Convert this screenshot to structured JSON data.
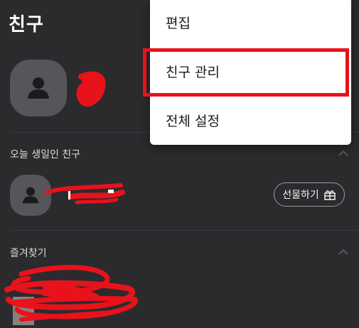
{
  "header": {
    "title": "친구"
  },
  "sections": {
    "birthday": {
      "label": "오늘 생일인 친구",
      "gift_button": "선물하기"
    },
    "favorites": {
      "label": "즐겨찾기"
    }
  },
  "menu": {
    "items": [
      {
        "label": "편집"
      },
      {
        "label": "친구 관리",
        "highlighted": true
      },
      {
        "label": "전체 설정"
      }
    ]
  },
  "colors": {
    "background": "#2b2b2e",
    "avatar": "#55555a",
    "menu_background": "#ffffff",
    "highlight": "#e8121b",
    "redaction": "#e8121b"
  },
  "icons": [
    "person-icon",
    "chevron-up-icon",
    "gift-icon"
  ]
}
